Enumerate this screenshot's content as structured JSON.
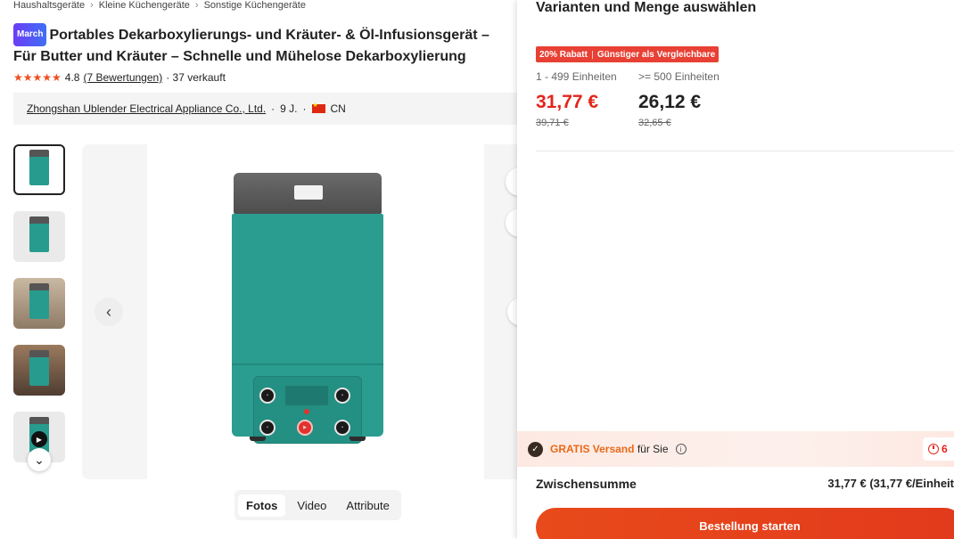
{
  "breadcrumb": [
    "Haushaltsgeräte",
    "Kleine Küchengeräte",
    "Sonstige Küchengeräte"
  ],
  "product": {
    "badge": "March",
    "title": "Portables Dekarboxylierungs- und Kräuter- & Öl-Infusionsgerät – Für Butter und Kräuter – Schnelle und Mühelose Dekarboxylierung",
    "rating": "4.8",
    "stars": 5,
    "reviews": "(7 Bewertungen)",
    "sold": "· 37 verkauft"
  },
  "supplier": {
    "name": "Zhongshan Ublender Electrical Appliance Co., Ltd.",
    "years": "9 J.",
    "country": "CN",
    "sep": "·"
  },
  "media_tabs": [
    "Fotos",
    "Video",
    "Attribute"
  ],
  "media_active_tab": "Fotos",
  "drawer": {
    "title": "Varianten und Menge auswählen",
    "promo_discount": "20% Rabatt",
    "promo_text": "Günstiger als Vergleichbare",
    "tiers": [
      {
        "range": "1 - 499 Einheiten",
        "price": "31,77 €",
        "old": "39,71 €"
      },
      {
        "range": ">= 500 Einheiten",
        "price": "26,12 €",
        "old": "32,65 €"
      }
    ],
    "shipping_strong": "GRATIS Versand",
    "shipping_rest": "für Sie",
    "timer": "6",
    "subtotal_label": "Zwischensumme",
    "subtotal_value": "31,77 € (31,77 €/Einheit",
    "order_button": "Bestellung starten"
  },
  "colors": {
    "accent": "#e84a1b",
    "price_red": "#e3251b",
    "device_teal": "#2a9d90"
  }
}
